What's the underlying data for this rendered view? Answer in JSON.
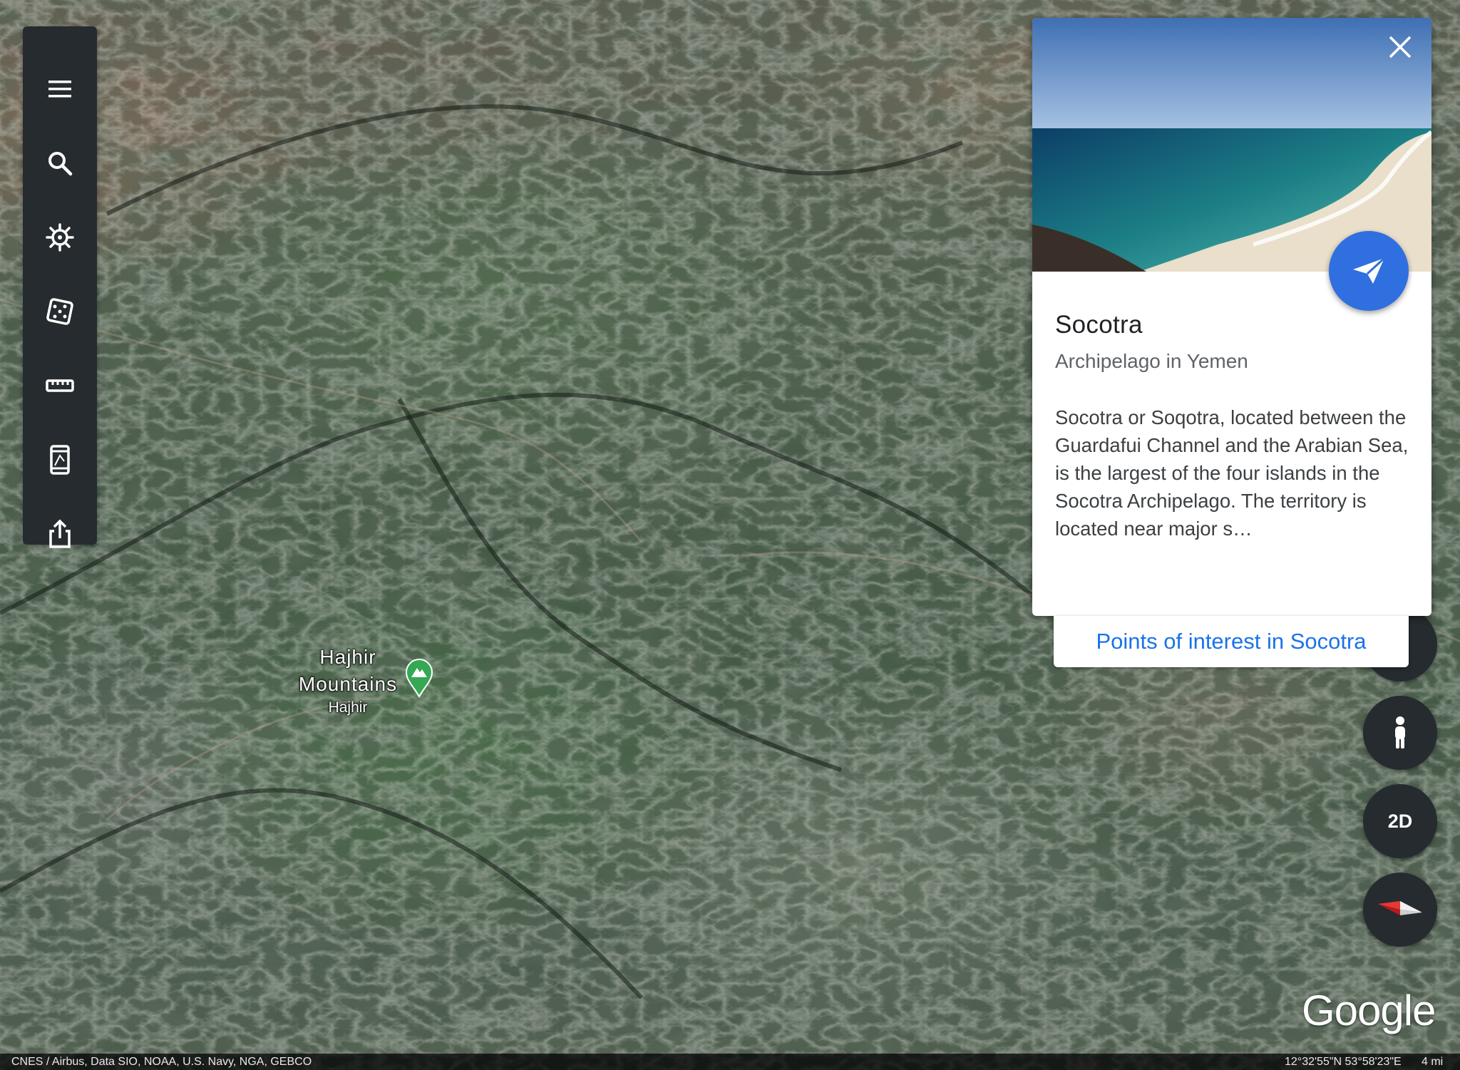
{
  "toolbar": {
    "items": [
      {
        "name": "menu",
        "icon": "menu-icon"
      },
      {
        "name": "search",
        "icon": "search-icon"
      },
      {
        "name": "voyager",
        "icon": "voyager-wheel-icon"
      },
      {
        "name": "feeling-lucky",
        "icon": "dice-icon"
      },
      {
        "name": "measure",
        "icon": "ruler-icon"
      },
      {
        "name": "projects",
        "icon": "tablet-icon"
      },
      {
        "name": "share",
        "icon": "share-icon"
      }
    ]
  },
  "card": {
    "title": "Socotra",
    "subtitle": "Archipelago in Yemen",
    "description": "Socotra or Soqotra, located between the Guardafui Channel and the Arabian Sea, is the largest of the four islands in the Socotra Archipelago. The territory is located near major s…",
    "points_of_interest_label": "Points of interest in Socotra",
    "close_icon": "close-icon",
    "fly_icon": "paper-plane-icon",
    "accent_color": "#2f6fe0",
    "link_color": "#1a73e8"
  },
  "map": {
    "place_name": "Hajhir Mountains",
    "place_sub": "Hajhir",
    "marker_icon": "mountain-marker-icon",
    "marker_color": "#34a853"
  },
  "controls": {
    "view_mode_label": "2D",
    "pegman_icon": "pegman-icon",
    "compass_icon": "compass-icon"
  },
  "branding": {
    "logo_text": "Google"
  },
  "status_bar": {
    "attribution": "CNES / Airbus, Data SIO, NOAA, U.S. Navy, NGA, GEBCO",
    "coordinates": "12°32'55\"N 53°58'23\"E",
    "scale": "4 mi"
  }
}
